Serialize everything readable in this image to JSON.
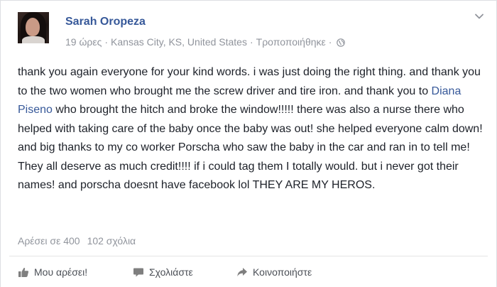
{
  "post": {
    "author": "Sarah Oropeza",
    "time": "19 ώρες",
    "location": "Kansas City, KS, United States",
    "edited": "Τροποποιήθηκε",
    "sep1": "·",
    "sep2": "·",
    "sep3": "·",
    "text_before_mention": "thank you again everyone for your kind words. i was just doing the right thing. and thank you to the two women who brought me the screw driver and tire iron. and thank you to ",
    "mention": "Diana Piseno",
    "text_after_mention": " who brought the hitch and broke the window!!!!! there was also a nurse there who helped with taking care of the baby once the baby was out! she helped everyone calm down! and big thanks to my co worker Porscha who saw the baby in the car and ran in to tell me! They all deserve as much credit!!!! if i could tag them I totally would. but i never got their names! and porscha doesnt have facebook lol THEY ARE MY HEROS."
  },
  "counts": {
    "likes": "Αρέσει σε 400",
    "comments": "102 σχόλια"
  },
  "actions": {
    "like": "Μου αρέσει!",
    "comment": "Σχολιάστε",
    "share": "Κοινοποιήστε"
  },
  "icons": {
    "menu": "chevron-down-icon",
    "audience": "globe-icon",
    "like": "thumbs-up-icon",
    "comment": "speech-bubble-icon",
    "share": "share-arrow-icon"
  },
  "colors": {
    "link": "#365899",
    "text": "#1d2129",
    "muted": "#90949c",
    "action": "#4b4f56"
  }
}
